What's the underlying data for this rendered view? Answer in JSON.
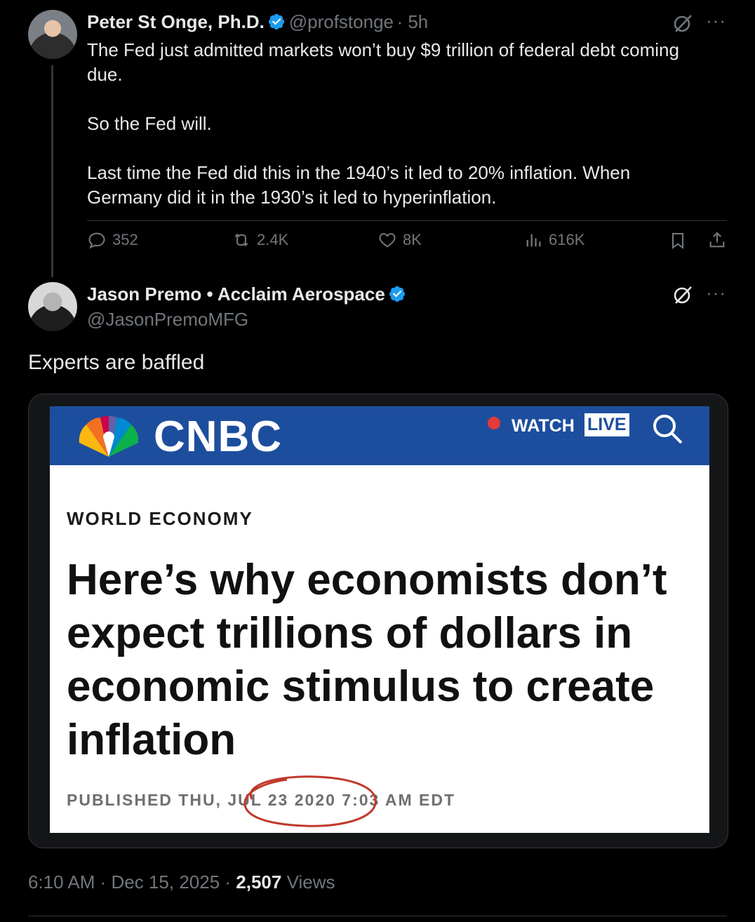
{
  "quoted_tweet": {
    "author_name": "Peter St Onge, Ph.D.",
    "author_handle": "@profstonge",
    "time_ago": "· 5h",
    "text_lines": [
      "The Fed just admitted markets won’t buy $9 trillion of federal debt coming",
      "due.",
      "So the Fed will.",
      "Last time the Fed did this in the 1940’s it led to 20% inflation. When",
      "Germany did it in the 1930’s it led to hyperinflation."
    ],
    "replies": "352",
    "reposts": "2.4K",
    "likes": "8K",
    "views": "616K"
  },
  "main_tweet": {
    "author_name": "Jason Premo • Acclaim Aerospace",
    "author_handle": "@JasonPremoMFG",
    "text": "Experts are baffled",
    "timestamp": "6:10 AM · Dec 15, 2025 · ",
    "view_count": "2,507",
    "views_label": " Views"
  },
  "embedded_image": {
    "logo": "CNBC",
    "watch_label": "WATCH",
    "live_label": "LIVE",
    "section": "WORLD ECONOMY",
    "headline": "Here’s why economists don’t expect trillions of dollars in economic stimulus to create inflation",
    "published_prefix": "PUBLISHED THU, ",
    "published_date": "JUL 23 2020",
    "published_suffix": " 7:03 AM EDT"
  },
  "colors": {
    "background": "#000000",
    "text_primary": "#e7e9ea",
    "text_secondary": "#71767b",
    "verified_blue": "#1d9bf0",
    "cnbc_blue": "#1d4e9e",
    "circle_red": "#c0392b"
  },
  "icons": [
    "verified-icon",
    "grok-icon",
    "more-icon",
    "reply-icon",
    "repost-icon",
    "like-icon",
    "views-icon",
    "bookmark-icon",
    "share-icon",
    "search-icon",
    "peacock-icon"
  ]
}
